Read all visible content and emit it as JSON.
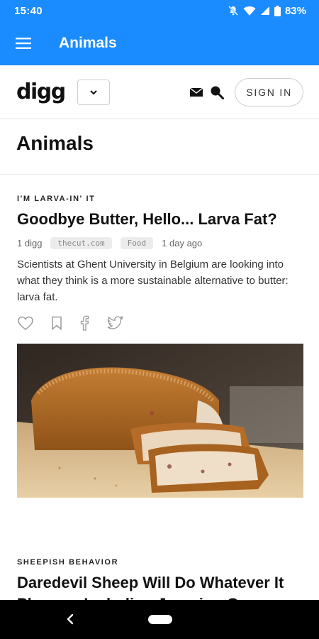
{
  "status_bar": {
    "time": "15:40",
    "battery": "83%"
  },
  "app_bar": {
    "title": "Animals"
  },
  "site_header": {
    "logo": "digg",
    "sign_in_label": "SIGN IN"
  },
  "page": {
    "title": "Animals"
  },
  "articles": [
    {
      "kicker": "I'M LARVA-IN' IT",
      "headline": "Goodbye Butter, Hello... Larva Fat?",
      "diggs": "1 digg",
      "source": "thecut.com",
      "category": "Food",
      "date": "1 day ago",
      "excerpt": "Scientists at Ghent University in Belgium are looking into what they think is a more sustainable alternative to butter: larva fat."
    },
    {
      "kicker": "SHEEPISH BEHAVIOR",
      "headline": "Daredevil Sheep Will Do Whatever It Pleases, Including Jumping Over"
    }
  ],
  "colors": {
    "brand_blue": "#1a8cff"
  },
  "icons": [
    "menu-icon",
    "chevron-down-icon",
    "mail-icon",
    "search-icon",
    "heart-icon",
    "bookmark-icon",
    "facebook-icon",
    "twitter-icon",
    "back-icon"
  ]
}
